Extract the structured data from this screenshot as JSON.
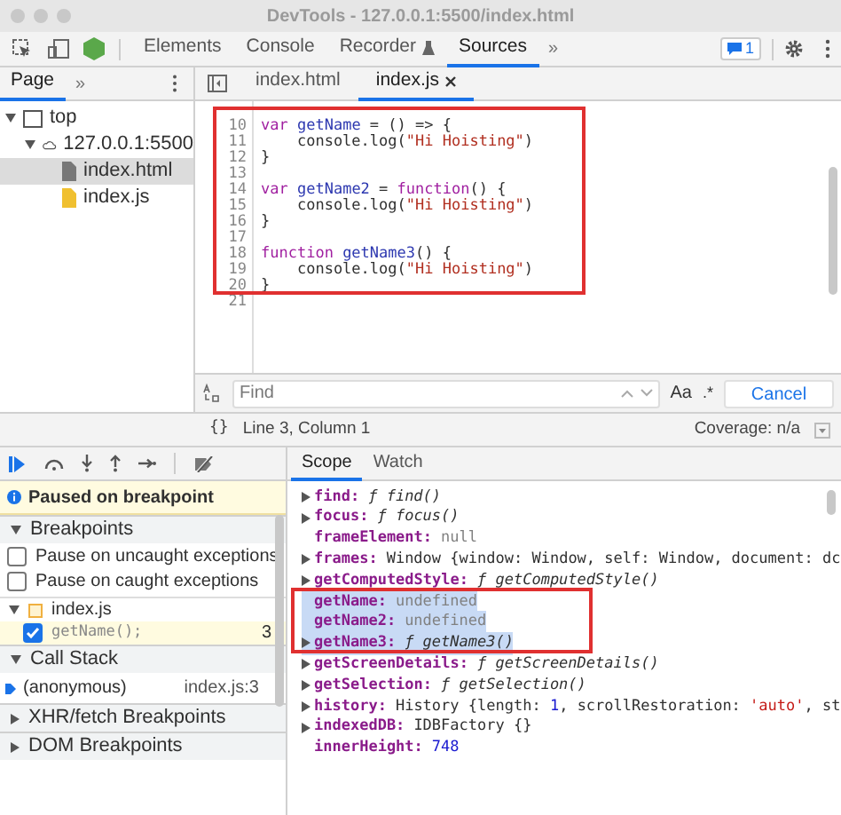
{
  "window": {
    "title": "DevTools - 127.0.0.1:5500/index.html"
  },
  "main_tabs": [
    {
      "label": "Elements",
      "selected": false,
      "kind": "plain"
    },
    {
      "label": "Console",
      "selected": false,
      "kind": "plain"
    },
    {
      "label": "Recorder",
      "selected": false,
      "kind": "flask"
    },
    {
      "label": "Sources",
      "selected": true,
      "kind": "plain"
    }
  ],
  "more_tabs": "»",
  "issues_badge": "1",
  "navigator": {
    "tab": {
      "label": "Page",
      "selected": true
    },
    "more": "»",
    "tree": [
      {
        "label": "top",
        "kind": "frame",
        "expanded": true,
        "selected": false,
        "children": [
          {
            "label": "127.0.0.1:5500",
            "kind": "cloud",
            "expanded": true,
            "selected": false,
            "children": [
              {
                "label": "index.html",
                "kind": "html",
                "selected": true
              },
              {
                "label": "index.js",
                "kind": "js",
                "selected": false
              }
            ]
          }
        ]
      }
    ]
  },
  "file_tabs": [
    {
      "label": "index.html",
      "selected": false,
      "closable": false
    },
    {
      "label": "index.js",
      "selected": true,
      "closable": true
    }
  ],
  "code": [
    {
      "number": "10",
      "tokens": [
        {
          "kind": "keyword",
          "text": "var "
        },
        {
          "kind": "name",
          "text": "getName"
        },
        {
          "kind": "plain",
          "text": " = () => {"
        }
      ]
    },
    {
      "number": "11",
      "tokens": [
        {
          "kind": "plain",
          "text": "    console.log("
        },
        {
          "kind": "string",
          "text": "\"Hi Hoisting\""
        },
        {
          "kind": "plain",
          "text": ")"
        }
      ]
    },
    {
      "number": "12",
      "tokens": [
        {
          "kind": "plain",
          "text": "}"
        }
      ]
    },
    {
      "number": "13"
    },
    {
      "number": "14",
      "tokens": [
        {
          "kind": "keyword",
          "text": "var "
        },
        {
          "kind": "name",
          "text": "getName2"
        },
        {
          "kind": "plain",
          "text": " = "
        },
        {
          "kind": "keyword",
          "text": "function"
        },
        {
          "kind": "plain",
          "text": "() {"
        }
      ]
    },
    {
      "number": "15",
      "tokens": [
        {
          "kind": "plain",
          "text": "    console.log("
        },
        {
          "kind": "string",
          "text": "\"Hi Hoisting\""
        },
        {
          "kind": "plain",
          "text": ")"
        }
      ]
    },
    {
      "number": "16",
      "tokens": [
        {
          "kind": "plain",
          "text": "}"
        }
      ]
    },
    {
      "number": "17"
    },
    {
      "number": "18",
      "tokens": [
        {
          "kind": "keyword",
          "text": "function "
        },
        {
          "kind": "name",
          "text": "getName3"
        },
        {
          "kind": "plain",
          "text": "() {"
        }
      ]
    },
    {
      "number": "19",
      "tokens": [
        {
          "kind": "plain",
          "text": "    console.log("
        },
        {
          "kind": "string",
          "text": "\"Hi Hoisting\""
        },
        {
          "kind": "plain",
          "text": ")"
        }
      ]
    },
    {
      "number": "20",
      "tokens": [
        {
          "kind": "plain",
          "text": "}"
        }
      ]
    },
    {
      "number": "21"
    }
  ],
  "find_bar": {
    "placeholder": "Find",
    "case_toggle": "Aa",
    "regex_toggle": ".*",
    "cancel": "Cancel"
  },
  "status_bar": {
    "format": "{}",
    "position": "Line 3, Column 1",
    "coverage": "Coverage: n/a"
  },
  "paused_banner": "Paused on breakpoint",
  "breakpoints": {
    "title": "Breakpoints",
    "expanded": true,
    "options": [
      {
        "label": "Pause on uncaught exceptions",
        "checked": false
      },
      {
        "label": "Pause on caught exceptions",
        "checked": false
      }
    ],
    "files": [
      {
        "name": "index.js",
        "expanded": true,
        "items": [
          {
            "code": "getName();",
            "line": "3",
            "checked": true
          }
        ]
      }
    ]
  },
  "call_stack": {
    "title": "Call Stack",
    "expanded": true,
    "frames": [
      {
        "name": "(anonymous)",
        "location": "index.js:3",
        "selected": true
      }
    ]
  },
  "collapsed_sections": [
    {
      "title": "XHR/fetch Breakpoints",
      "expanded": false
    },
    {
      "title": "DOM Breakpoints",
      "expanded": false
    }
  ],
  "sidebar_tabs": [
    {
      "label": "Scope",
      "selected": true
    },
    {
      "label": "Watch",
      "selected": false
    }
  ],
  "scope": [
    {
      "name": "find:",
      "expandable": true,
      "selected": false,
      "value": [
        {
          "kind": "func",
          "text": "ƒ find()"
        }
      ]
    },
    {
      "name": "focus:",
      "expandable": true,
      "selected": false,
      "value": [
        {
          "kind": "func",
          "text": "ƒ focus()"
        }
      ]
    },
    {
      "name": "frameElement:",
      "expandable": false,
      "selected": false,
      "value": [
        {
          "kind": "null",
          "text": "null"
        }
      ]
    },
    {
      "name": "frames:",
      "expandable": true,
      "selected": false,
      "value": [
        {
          "kind": "plain",
          "text": "Window {"
        },
        {
          "kind": "plain",
          "text": "window: Window, self: Window, document: dc"
        }
      ]
    },
    {
      "name": "getComputedStyle:",
      "expandable": true,
      "selected": false,
      "value": [
        {
          "kind": "func",
          "text": "ƒ getComputedStyle()"
        }
      ]
    },
    {
      "name": "getName:",
      "expandable": false,
      "selected": true,
      "value": [
        {
          "kind": "null",
          "text": "undefined"
        }
      ]
    },
    {
      "name": "getName2:",
      "expandable": false,
      "selected": true,
      "value": [
        {
          "kind": "null",
          "text": "undefined"
        }
      ]
    },
    {
      "name": "getName3:",
      "expandable": true,
      "selected": true,
      "value": [
        {
          "kind": "func",
          "text": "ƒ getName3()"
        }
      ]
    },
    {
      "name": "getScreenDetails:",
      "expandable": true,
      "selected": false,
      "value": [
        {
          "kind": "func",
          "text": "ƒ getScreenDetails()"
        }
      ]
    },
    {
      "name": "getSelection:",
      "expandable": true,
      "selected": false,
      "value": [
        {
          "kind": "func",
          "text": "ƒ getSelection()"
        }
      ]
    },
    {
      "name": "history:",
      "expandable": true,
      "selected": false,
      "value": [
        {
          "kind": "plain",
          "text": "History {length: "
        },
        {
          "kind": "number",
          "text": "1"
        },
        {
          "kind": "plain",
          "text": ", scrollRestoration: "
        },
        {
          "kind": "string",
          "text": "'auto'"
        },
        {
          "kind": "plain",
          "text": ", st"
        }
      ]
    },
    {
      "name": "indexedDB:",
      "expandable": true,
      "selected": false,
      "value": [
        {
          "kind": "plain",
          "text": "IDBFactory {}"
        }
      ]
    },
    {
      "name": "innerHeight:",
      "expandable": false,
      "selected": false,
      "value": [
        {
          "kind": "number",
          "text": "748"
        }
      ]
    }
  ]
}
